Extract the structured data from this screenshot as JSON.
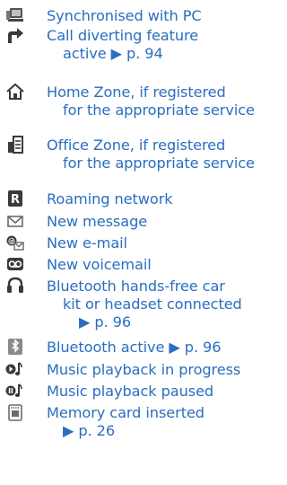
{
  "colors": {
    "text": "#2a6ec0",
    "icon_dark": "#3a3a3a",
    "icon_mid": "#8a8a8a"
  },
  "items": [
    {
      "icon": "pc-sync-icon",
      "lines": [
        "Synchronised with PC"
      ]
    },
    {
      "icon": "call-divert-icon",
      "lines": [
        "Call diverting feature",
        "active ▶ p. 94"
      ]
    },
    {
      "icon": "home-zone-icon",
      "lines": [
        "Home Zone, if registered",
        "for the appropriate service"
      ]
    },
    {
      "icon": "office-zone-icon",
      "lines": [
        "Office Zone, if registered",
        "for the appropriate service"
      ]
    },
    {
      "icon": "roaming-icon",
      "lines": [
        "Roaming network"
      ]
    },
    {
      "icon": "envelope-icon",
      "lines": [
        "New message"
      ]
    },
    {
      "icon": "email-icon",
      "lines": [
        "New e-mail"
      ]
    },
    {
      "icon": "voicemail-icon",
      "lines": [
        "New voicemail"
      ]
    },
    {
      "icon": "headset-icon",
      "lines": [
        "Bluetooth hands-free car",
        "kit or headset connected",
        "▶ p. 96"
      ]
    },
    {
      "icon": "bluetooth-icon",
      "lines": [
        "Bluetooth active ▶ p. 96"
      ]
    },
    {
      "icon": "music-playing-icon",
      "lines": [
        "Music playback in progress"
      ]
    },
    {
      "icon": "music-paused-icon",
      "lines": [
        "Music playback paused"
      ]
    },
    {
      "icon": "memory-card-icon",
      "lines": [
        "Memory card inserted",
        "▶ p. 26"
      ]
    }
  ]
}
